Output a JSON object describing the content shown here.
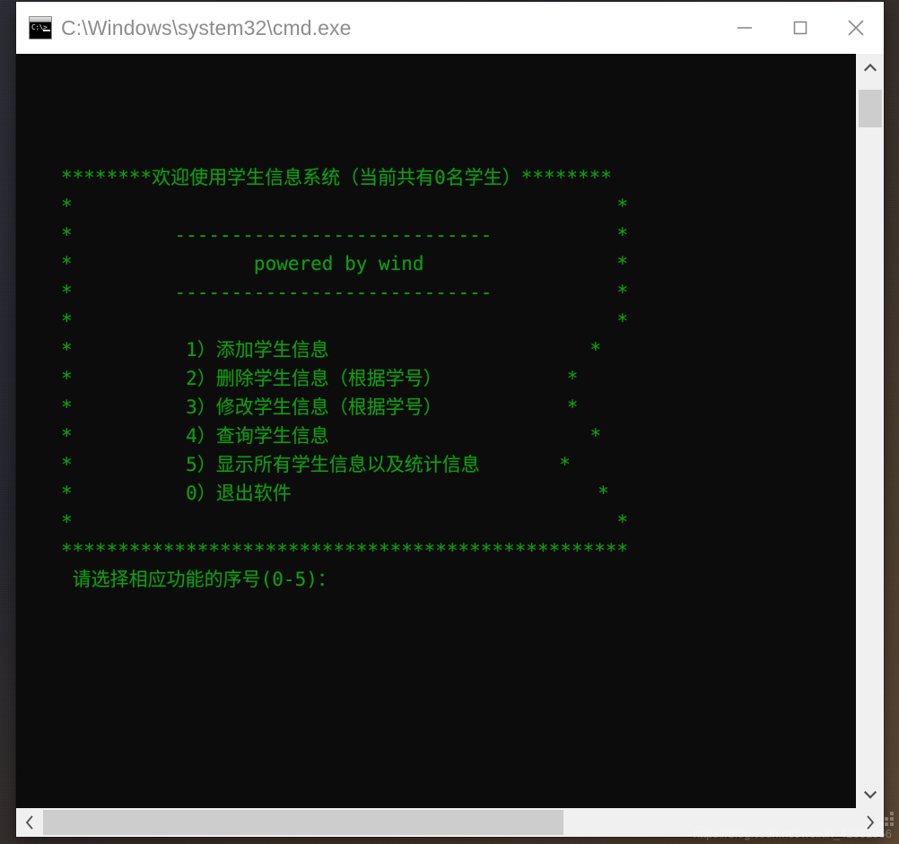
{
  "window": {
    "title": "C:\\Windows\\system32\\cmd.exe",
    "icon_name": "cmd-console-icon",
    "icon_prompt_text": "C:\\>",
    "minimize_label": "Minimize",
    "maximize_label": "Maximize",
    "close_label": "Close"
  },
  "console": {
    "background_color": "#0c0c0c",
    "text_color": "#119d11",
    "lines": [
      "********欢迎使用学生信息系统（当前共有0名学生）********",
      "*                                                *",
      "*         ----------------------------           *",
      "*                powered by wind                 *",
      "*         ----------------------------           *",
      "*                                                *",
      "*          1）添加学生信息                       *",
      "*          2）删除学生信息（根据学号）           *",
      "*          3）修改学生信息（根据学号）           *",
      "*          4）查询学生信息                       *",
      "*          5）显示所有学生信息以及统计信息       *",
      "*          0）退出软件                           *",
      "*                                                *",
      "**************************************************",
      " 请选择相应功能的序号(0-5)："
    ],
    "header": "********欢迎使用学生信息系统（当前共有0名学生）********",
    "branding": "powered by wind",
    "separator": "----------------------------",
    "menu_items": [
      "1）添加学生信息",
      "2）删除学生信息（根据学号）",
      "3）修改学生信息（根据学号）",
      "4）查询学生信息",
      "5）显示所有学生信息以及统计信息",
      "0）退出软件"
    ],
    "footer_rule": "**************************************************",
    "prompt": " 请选择相应功能的序号(0-5)：",
    "student_count": "0"
  },
  "scrollbars": {
    "vertical": {
      "up_arrow": "▲",
      "down_arrow": "▼"
    },
    "horizontal": {
      "left_arrow": "‹",
      "right_arrow": "›"
    }
  },
  "watermark": {
    "text": "https://blog.csdn.net/weixin_42332956"
  }
}
